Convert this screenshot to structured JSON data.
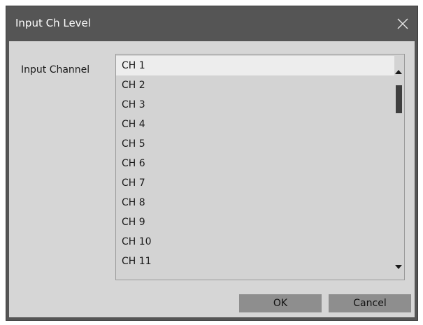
{
  "window": {
    "title": "Input Ch Level",
    "close_icon": "close-icon"
  },
  "form": {
    "label": "Input Channel",
    "selected": "CH 1",
    "channels": [
      "CH 1",
      "CH 2",
      "CH 3",
      "CH 4",
      "CH 5",
      "CH 6",
      "CH 7",
      "CH 8",
      "CH 9",
      "CH 10",
      "CH 11"
    ]
  },
  "buttons": {
    "ok_label": "OK",
    "cancel_label": "Cancel"
  },
  "colors": {
    "titlebar": "#555555",
    "client": "#d6d6d6",
    "selection": "#ededed",
    "button": "#8e8e8e"
  }
}
